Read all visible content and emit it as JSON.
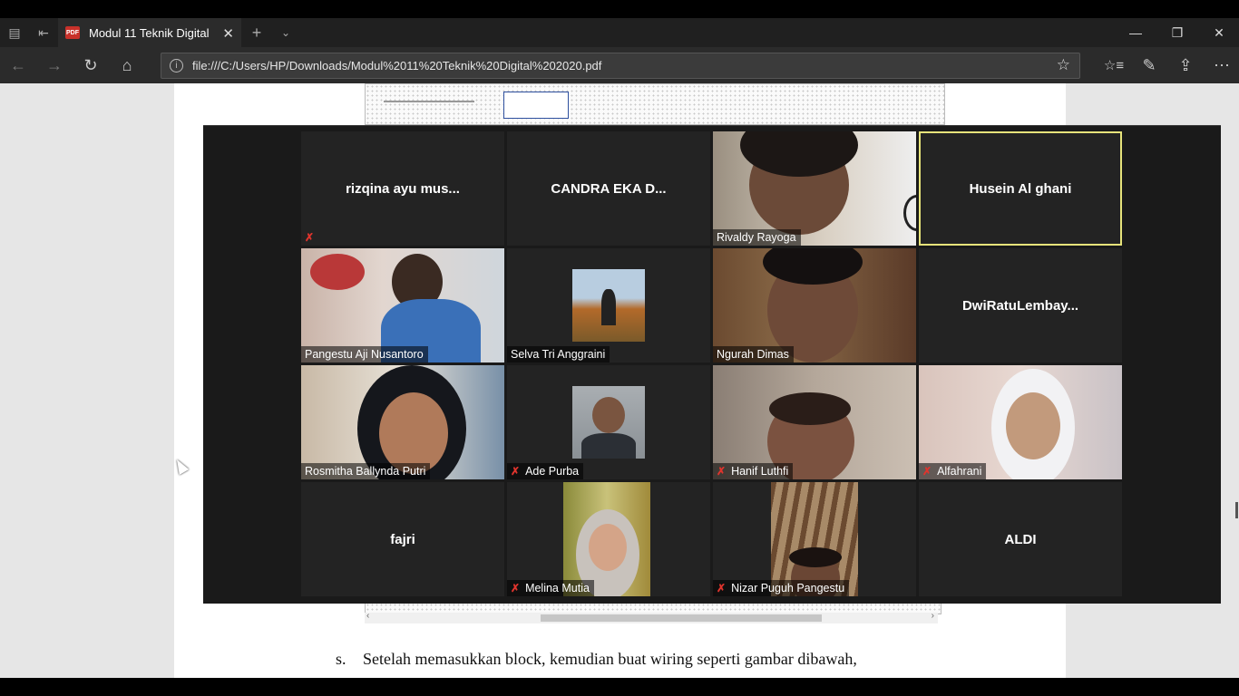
{
  "browser": {
    "tab_title": "Modul 11 Teknik Digital",
    "tab_close": "✕",
    "new_tab": "+",
    "tab_menu": "⌄",
    "url": "file:///C:/Users/HP/Downloads/Modul%2011%20Teknik%20Digital%202020.pdf",
    "window": {
      "minimize": "—",
      "restore": "❐",
      "close": "✕"
    },
    "nav": {
      "back": "←",
      "forward": "→",
      "refresh": "↻",
      "home": "⌂"
    },
    "toolbar": {
      "favorite": "☆",
      "favorites_list": "☆≡",
      "notes": "✎",
      "share": "⇪",
      "more": "⋯"
    }
  },
  "document": {
    "paragraph_letter": "s.",
    "paragraph_text": "Setelah memasukkan block, kemudian buat wiring seperti gambar dibawah,"
  },
  "meeting": {
    "mute_glyph": "✗",
    "participants": [
      {
        "name": "rizqina ayu mus...",
        "video": false,
        "muted": true
      },
      {
        "name": "CANDRA EKA D...",
        "video": false,
        "muted": false
      },
      {
        "name": "Rivaldy Rayoga",
        "video": true,
        "muted": false
      },
      {
        "name": "Husein Al ghani",
        "video": false,
        "muted": false,
        "active_speaker": true
      },
      {
        "name": "Pangestu Aji Nusantoro",
        "video": true,
        "muted": false
      },
      {
        "name": "Selva Tri Anggraini",
        "video": true,
        "muted": false
      },
      {
        "name": "Ngurah Dimas",
        "video": true,
        "muted": false
      },
      {
        "name": "DwiRatuLembay...",
        "video": false,
        "muted": false
      },
      {
        "name": "Rosmitha Ballynda Putri",
        "video": true,
        "muted": false
      },
      {
        "name": "Ade Purba",
        "video": true,
        "muted": true
      },
      {
        "name": "Hanif Luthfi",
        "video": true,
        "muted": true
      },
      {
        "name": "Alfahrani",
        "video": true,
        "muted": true
      },
      {
        "name": "fajri",
        "video": false,
        "muted": false
      },
      {
        "name": "Melina Mutia",
        "video": true,
        "muted": true
      },
      {
        "name": "Nizar Puguh Pangestu",
        "video": true,
        "muted": true
      },
      {
        "name": "ALDI",
        "video": false,
        "muted": false
      }
    ]
  },
  "colors": {
    "active_speaker_border": "#e6e37a",
    "mute": "#e0342d",
    "tile_bg": "#232323"
  }
}
